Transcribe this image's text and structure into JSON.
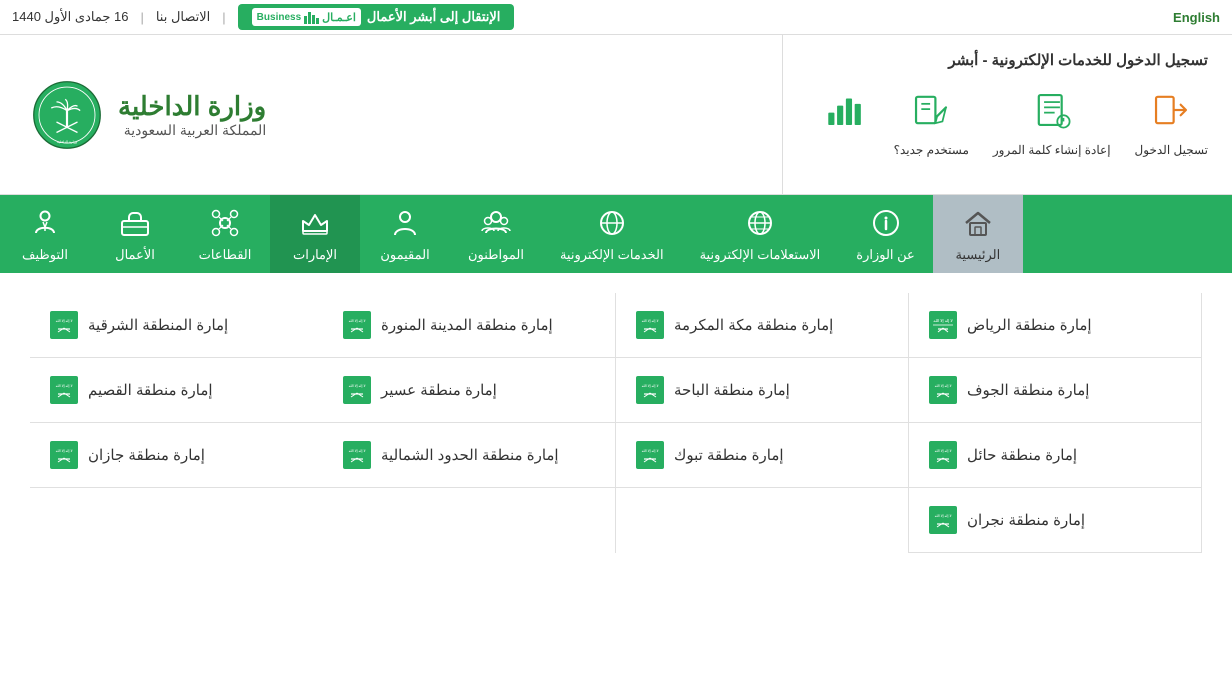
{
  "topbar": {
    "english_label": "English",
    "contact_label": "الاتصال بنا",
    "date_label": "16 جمادى الأول 1440",
    "absher_btn": "الإنتقال إلى أبشر الأعمال",
    "business_label": "اعـمـال",
    "business_sub": "Business"
  },
  "header": {
    "login_title": "تسجيل الدخول للخدمات الإلكترونية - أبشر",
    "login_options": [
      {
        "label": "تسجيل الدخول",
        "icon": "login"
      },
      {
        "label": "إعادة إنشاء كلمة المرور",
        "icon": "reset"
      },
      {
        "label": "مستخدم جديد؟",
        "icon": "newuser"
      },
      {
        "label": "",
        "icon": "chart"
      }
    ],
    "logo_title": "وزارة الداخلية",
    "logo_subtitle": "المملكة العربية السعودية"
  },
  "nav": {
    "items": [
      {
        "label": "الرئيسية",
        "icon": "home",
        "active": false
      },
      {
        "label": "عن الوزارة",
        "icon": "info",
        "active": false
      },
      {
        "label": "الاستعلامات الإلكترونية",
        "icon": "globe2",
        "active": false
      },
      {
        "label": "الخدمات الإلكترونية",
        "icon": "globe1",
        "active": false
      },
      {
        "label": "المواطنون",
        "icon": "citizen",
        "active": false
      },
      {
        "label": "المقيمون",
        "icon": "residents",
        "active": false
      },
      {
        "label": "الإمارات",
        "icon": "emirates",
        "active": true
      },
      {
        "label": "القطاعات",
        "icon": "sectors",
        "active": false
      },
      {
        "label": "الأعمال",
        "icon": "business",
        "active": false
      },
      {
        "label": "التوظيف",
        "icon": "employment",
        "active": false
      }
    ]
  },
  "regions": {
    "items": [
      "إمارة منطقة الرياض",
      "إمارة منطقة مكة المكرمة",
      "إمارة منطقة المدينة المنورة",
      "إمارة المنطقة الشرقية",
      "إمارة منطقة الجوف",
      "إمارة منطقة الباحة",
      "إمارة منطقة عسير",
      "إمارة منطقة القصيم",
      "إمارة منطقة حائل",
      "إمارة منطقة تبوك",
      "إمارة منطقة الحدود الشمالية",
      "إمارة منطقة جازان",
      "إمارة منطقة نجران",
      "",
      "",
      ""
    ]
  }
}
